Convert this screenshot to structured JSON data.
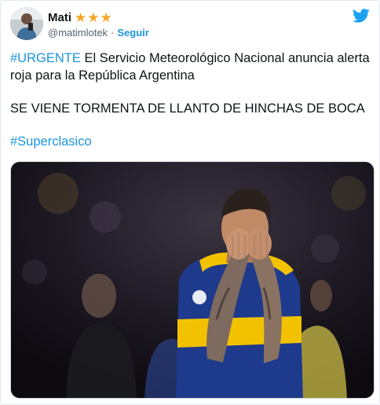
{
  "tweet": {
    "display_name": "Mati",
    "handle": "@matimlotek",
    "follow_label": "Seguir",
    "separator": "·",
    "stars": [
      "star-icon",
      "star-icon",
      "star-icon"
    ],
    "body": {
      "p1_hashtag": "#URGENTE",
      "p1_text": " El Servicio Meteorológico Nacional anuncia alerta roja para la República Argentina",
      "p2_text": "SE VIENE TORMENTA DE LLANTO DE HINCHAS DE BOCA",
      "p3_hashtag": "#Superclasico"
    }
  },
  "colors": {
    "link": "#1b95e0",
    "star": "#f5a623",
    "jersey_blue": "#1d3a8c",
    "jersey_yellow": "#f2c200"
  },
  "icons": {
    "brand": "twitter-bird-icon",
    "verified_like": "star-icon"
  }
}
